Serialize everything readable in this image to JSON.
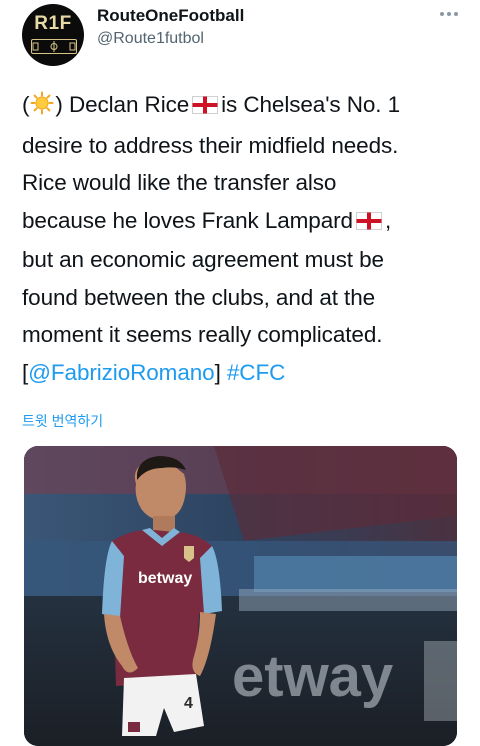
{
  "account": {
    "logo_text": "R1F",
    "display_name": "RouteOneFootball",
    "handle": "@Route1futbol"
  },
  "menu": {
    "more_icon": "more-horizontal-icon"
  },
  "tweet": {
    "lines": {
      "l1_open": "(",
      "l1_mid": ") Declan Rice",
      "l1_end": "is Chelsea's No. 1",
      "l2": "desire to address their midfield needs.",
      "l3": "Rice would like the transfer also",
      "l4_start": "because he loves Frank Lampard",
      "l4_end": ",",
      "l5": "but an economic agreement must be",
      "l6": "found between the clubs, and at the",
      "l7": "moment it seems really complicated.",
      "l8_open": "[",
      "l8_mention": "@FabrizioRomano",
      "l8_close": "]",
      "l8_hashtag": "#CFC"
    },
    "emoji": {
      "sun": "sun-emoji-icon",
      "flag": "england-flag-icon"
    },
    "translate_label": "트윗 번역하기"
  },
  "media": {
    "description_icon": "photo-player-icon",
    "shirt_text": "betway",
    "banner_text": "etway",
    "shorts_number": "4"
  },
  "colors": {
    "accent": "#1d9bf0",
    "text": "#0f1419",
    "muted": "#536471",
    "kit_claret": "#7a2b3f",
    "kit_blue": "#7fb3d8"
  }
}
